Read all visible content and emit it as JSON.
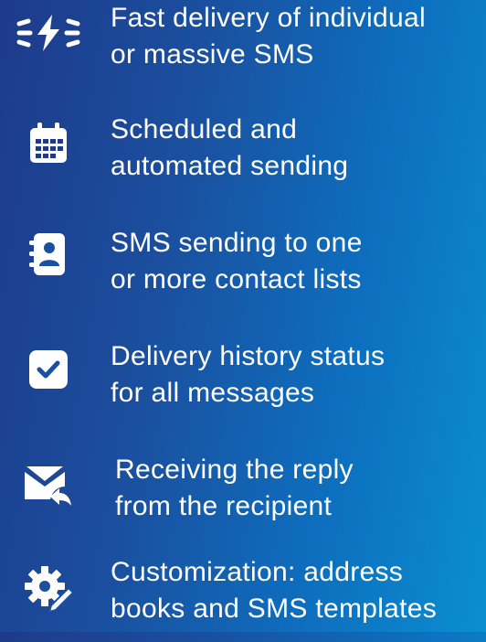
{
  "features": [
    {
      "icon": "lightning-icon",
      "line1": "Fast delivery of individual",
      "line2": "or massive SMS"
    },
    {
      "icon": "calendar-icon",
      "line1": "Scheduled and",
      "line2": "automated sending"
    },
    {
      "icon": "contact-card-icon",
      "line1": "SMS sending to one",
      "line2": "or more contact lists"
    },
    {
      "icon": "checkbox-icon",
      "line1": "Delivery history status",
      "line2": "for all messages"
    },
    {
      "icon": "mail-reply-icon",
      "line1": "Receiving the reply",
      "line2": "from the recipient"
    },
    {
      "icon": "settings-pen-icon",
      "line1": "Customization: address",
      "line2": "books and SMS templates"
    }
  ],
  "colors": {
    "text": "#ffffff",
    "background_start": "#1e3a8a",
    "background_end": "#0a8fd0"
  }
}
